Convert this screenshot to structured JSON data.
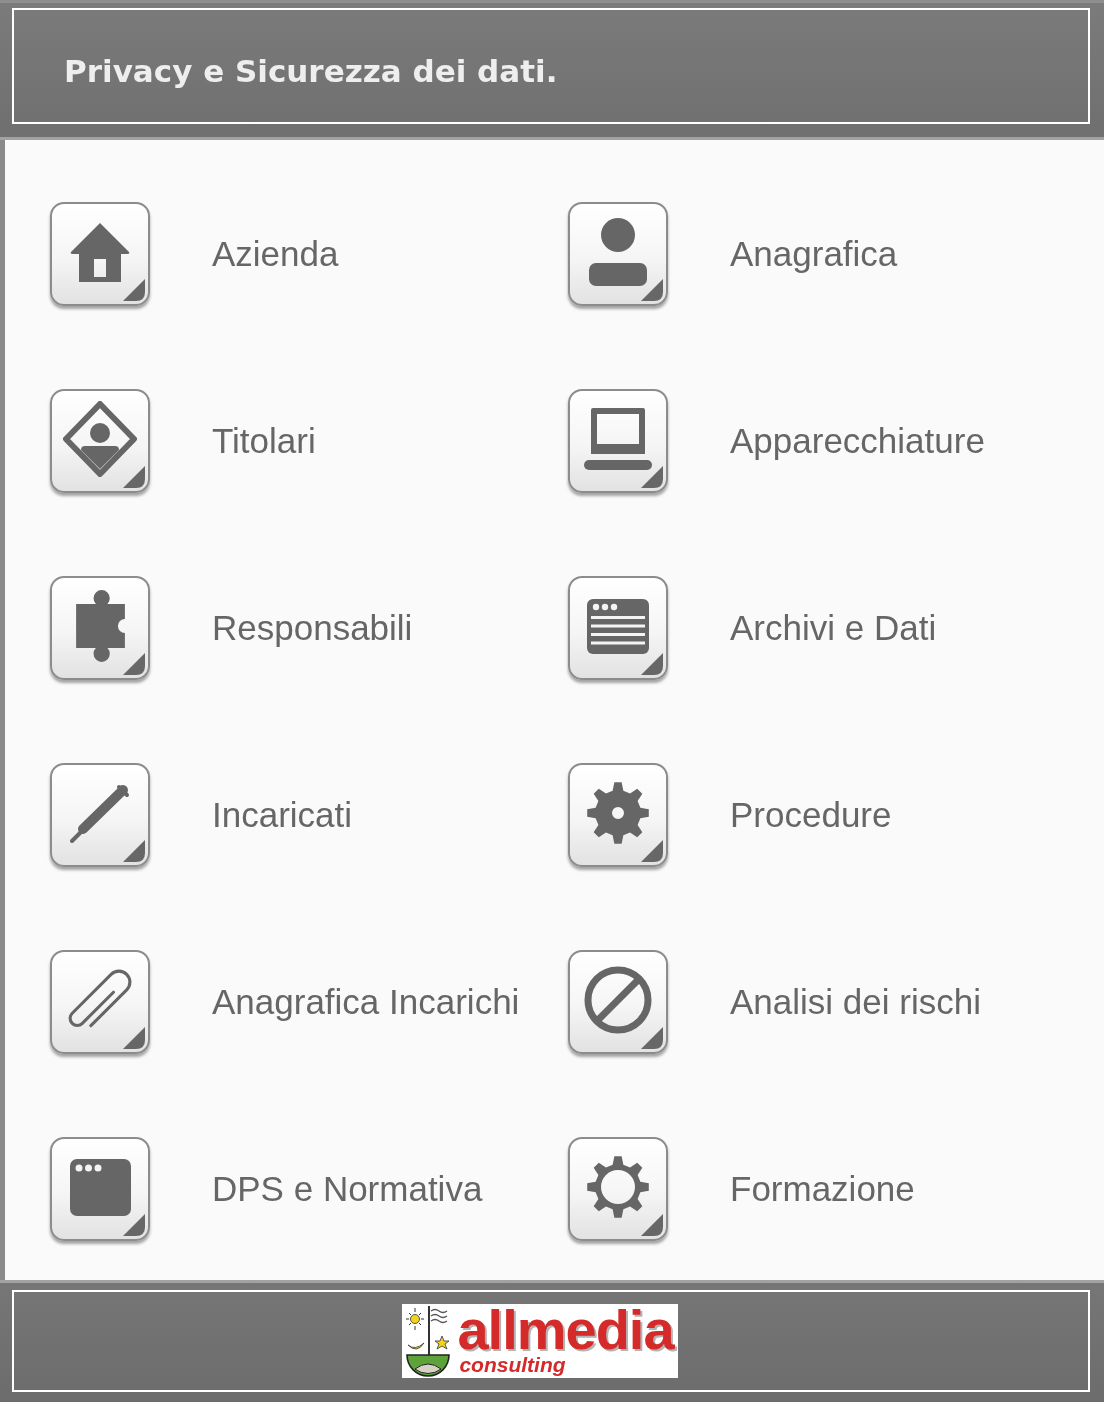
{
  "header": {
    "title": "Privacy e Sicurezza dei dati."
  },
  "menu": [
    {
      "label": "Azienda"
    },
    {
      "label": "Anagrafica"
    },
    {
      "label": "Titolari"
    },
    {
      "label": "Apparecchiature"
    },
    {
      "label": "Responsabili"
    },
    {
      "label": "Archivi e Dati"
    },
    {
      "label": "Incaricati"
    },
    {
      "label": "Procedure"
    },
    {
      "label": "Anagrafica Incarichi"
    },
    {
      "label": "Analisi dei rischi"
    },
    {
      "label": "DPS e Normativa"
    },
    {
      "label": "Formazione"
    }
  ],
  "footer": {
    "logo": {
      "wordmark": "allmedia",
      "tagline": "consulting"
    }
  }
}
